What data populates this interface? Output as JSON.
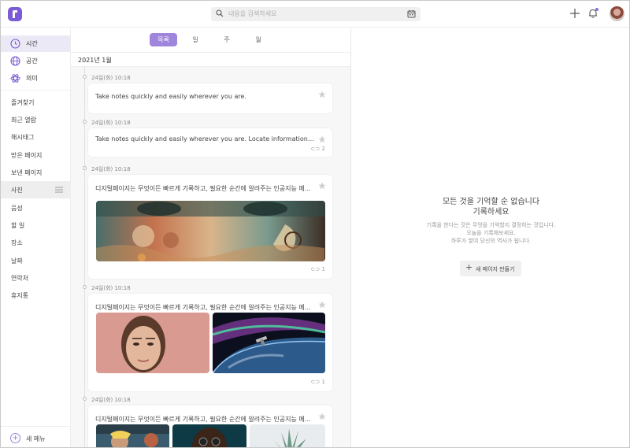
{
  "search": {
    "placeholder": "내용을 검색하세요"
  },
  "icons": {
    "logo": "app-logo-icon",
    "search": "search-icon",
    "calendar": "calendar-icon",
    "add": "plus-icon",
    "notifications": "bell-icon"
  },
  "colors": {
    "accent": "#9f86dc",
    "brand": "#7b5cd6",
    "active_bg": "#ece9f6"
  },
  "sidebar": {
    "views": [
      {
        "label": "시간",
        "icon": "clock-icon",
        "active": true
      },
      {
        "label": "공간",
        "icon": "globe-icon",
        "active": false
      },
      {
        "label": "의미",
        "icon": "atom-icon",
        "active": false
      }
    ],
    "items": [
      {
        "label": "즐겨찾기"
      },
      {
        "label": "최근 열람"
      },
      {
        "label": "해시태그"
      },
      {
        "label": "받은 페이지"
      },
      {
        "label": "보낸 페이지"
      },
      {
        "label": "사진",
        "active": true
      },
      {
        "label": "음성"
      },
      {
        "label": "할 일"
      },
      {
        "label": "장소"
      },
      {
        "label": "날짜"
      },
      {
        "label": "연락처"
      },
      {
        "label": "휴지통"
      }
    ],
    "new_menu": "새 메뉴"
  },
  "timeline": {
    "tabs": [
      {
        "label": "목록",
        "active": true
      },
      {
        "label": "일"
      },
      {
        "label": "주"
      },
      {
        "label": "월"
      }
    ],
    "month": "2021년 1월",
    "entries": [
      {
        "date": "24일(화) 10:18",
        "text": "Take notes quickly and easily wherever you are."
      },
      {
        "date": "24일(화) 10:18",
        "text": "Take notes quickly and easily wherever you are. Locate information faster.",
        "links": "2"
      },
      {
        "date": "24일(화) 10:18",
        "text": "디지털페이지는 무엇이든 빠르게 기록하고, 필요한 순간에 알려주는 인공지능 메모장...",
        "links": "1"
      },
      {
        "date": "24일(화) 10:18",
        "text": "디지털페이지는 무엇이든 빠르게 기록하고, 필요한 순간에 알려주는 인공지능 메모장...",
        "links": "1"
      },
      {
        "date": "24일(화) 10:18",
        "text": "디지털페이지는 무엇이든 빠르게 기록하고, 필요한 순간에 알려주는 인공지능 메모장..."
      }
    ]
  },
  "empty_state": {
    "title_line1": "모든 것을 기억할 순 없습니다",
    "title_line2": "기록하세요",
    "sub_line1": "기록을 한다는 것은 무엇을 기억할지 결정하는 것입니다.",
    "sub_line2": "오늘을 기록해보세요.",
    "sub_line3": "하루가 쌓여 당신의 역사가 됩니다.",
    "button": "새 페이지 만들기"
  }
}
